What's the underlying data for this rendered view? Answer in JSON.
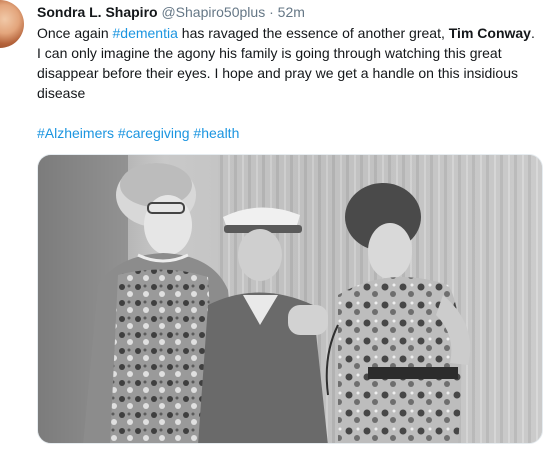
{
  "tweet": {
    "author_name": "Sondra L. Shapiro",
    "handle": "@Shapiro50plus",
    "separator": "·",
    "time": "52m",
    "text_part1": "Once again ",
    "hashtag_inline": "#dementia",
    "text_part2": " has ravaged the essence of another great, ",
    "bold_name": "Tim Conway",
    "text_part3": ". I can only imagine the agony his family is going through watching this great disappear before their eyes. I hope and pray we get a handle on this insidious disease",
    "hashtags": [
      "#Alzheimers",
      "#caregiving",
      "#health"
    ]
  },
  "colors": {
    "link": "#1b95e0",
    "muted": "#657786",
    "text": "#14171a"
  },
  "icons": {
    "avatar": "profile-photo",
    "media": "black-and-white-photo"
  }
}
